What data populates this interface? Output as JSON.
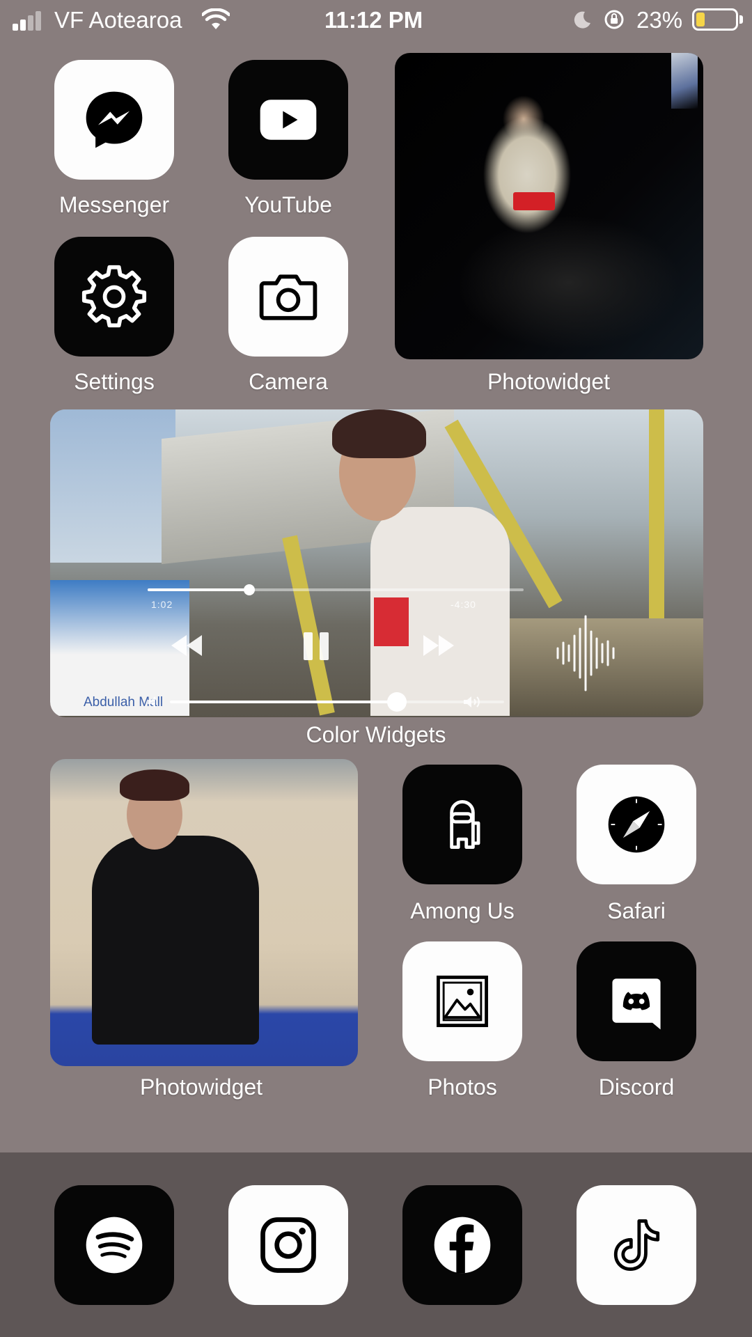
{
  "status_bar": {
    "carrier": "VF Aotearoa",
    "time": "11:12 PM",
    "battery_percent": "23%",
    "battery_level": 0.23,
    "signal_bars": 2,
    "icons": [
      "signal-icon",
      "wifi-icon",
      "moon-icon",
      "orientation-lock-icon",
      "battery-icon"
    ]
  },
  "apps": {
    "messenger": "Messenger",
    "youtube": "YouTube",
    "settings": "Settings",
    "camera": "Camera",
    "among_us": "Among Us",
    "safari": "Safari",
    "photos": "Photos",
    "discord": "Discord"
  },
  "widgets": {
    "photowidget_top": "Photowidget",
    "color_widgets": "Color Widgets",
    "photowidget_bottom": "Photowidget"
  },
  "player": {
    "elapsed": "1:02",
    "remaining": "-4:30",
    "progress": 0.27,
    "volume": 0.68,
    "poster_text": "Abdullah Mall"
  },
  "dock": {
    "apps": [
      "spotify",
      "instagram",
      "facebook",
      "tiktok"
    ]
  },
  "colors": {
    "background": "#887d7d",
    "dock": "#5e5656",
    "icon_white": "#fdfdfd",
    "icon_black": "#060606",
    "battery_fill": "#f6d548"
  }
}
